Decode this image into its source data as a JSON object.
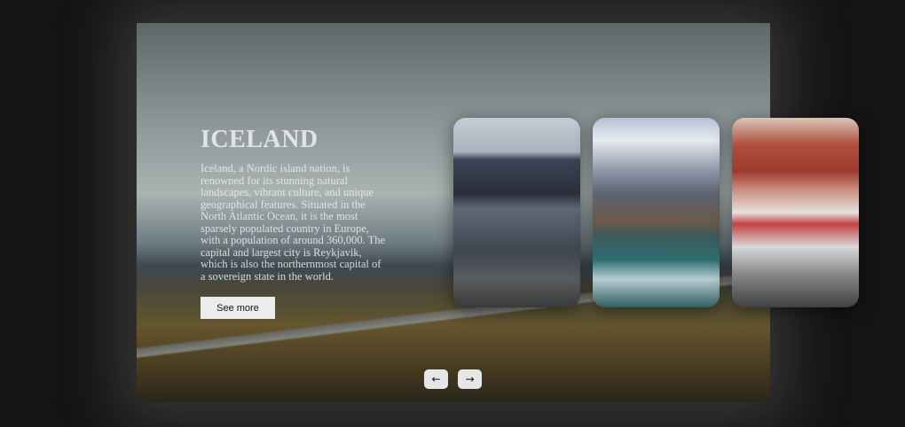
{
  "slide": {
    "title": "ICELAND",
    "description": "Iceland, a Nordic island nation, is renowned for its stunning natural landscapes, vibrant culture, and unique geographical features. Situated in the North Atlantic Ocean, it is the most sparsely populated country in Europe, with a population of around 360,000. The capital and largest city is Reykjavik, which is also the northernmost capital of a sovereign state in the world.",
    "button_label": "See more"
  },
  "cards": [
    {
      "subject": "harbor with pier and boat, mountains"
    },
    {
      "subject": "snowy mountain reflected in lake with cabin"
    },
    {
      "subject": "red houses and red boat in snowy harbor"
    }
  ],
  "navigation": {
    "prev_icon": "arrow-left-icon",
    "next_icon": "arrow-right-icon",
    "prev_glyph": "←",
    "next_glyph": "→"
  }
}
